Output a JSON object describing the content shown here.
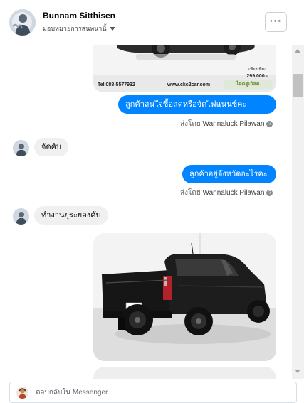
{
  "header": {
    "name": "Bunnam Sitthisen",
    "subtitle": "มอบหมายการสนทนานี้"
  },
  "ad_image": {
    "phone": "Tel.088-5577932",
    "website": "www.ckc2car.com",
    "price_label": "เพียงเพียง",
    "price": "299,000.-",
    "logo_text": "ไดตคูเกิลต"
  },
  "messages": [
    {
      "side": "out",
      "text": "ลูกค้าสนใจซื้อสดหรือจัดไฟแนนซ์คะ",
      "sent_by_prefix": "ส่งโดย",
      "sent_by_name": "Wannaluck Pilawan"
    },
    {
      "side": "in",
      "text": "จัดคับ"
    },
    {
      "side": "out",
      "text": "ลูกค้าอยู่จังหวัดอะไรคะ",
      "sent_by_prefix": "ส่งโดย",
      "sent_by_name": "Wannaluck Pilawan"
    },
    {
      "side": "in",
      "text": "ทำงานยุระยองคับ"
    }
  ],
  "truck_image": {
    "plate": "1กพ 4270"
  },
  "composer": {
    "placeholder": "ตอบกลับใน Messenger..."
  },
  "icons": {
    "more": "more-icon",
    "help": "help-icon"
  }
}
